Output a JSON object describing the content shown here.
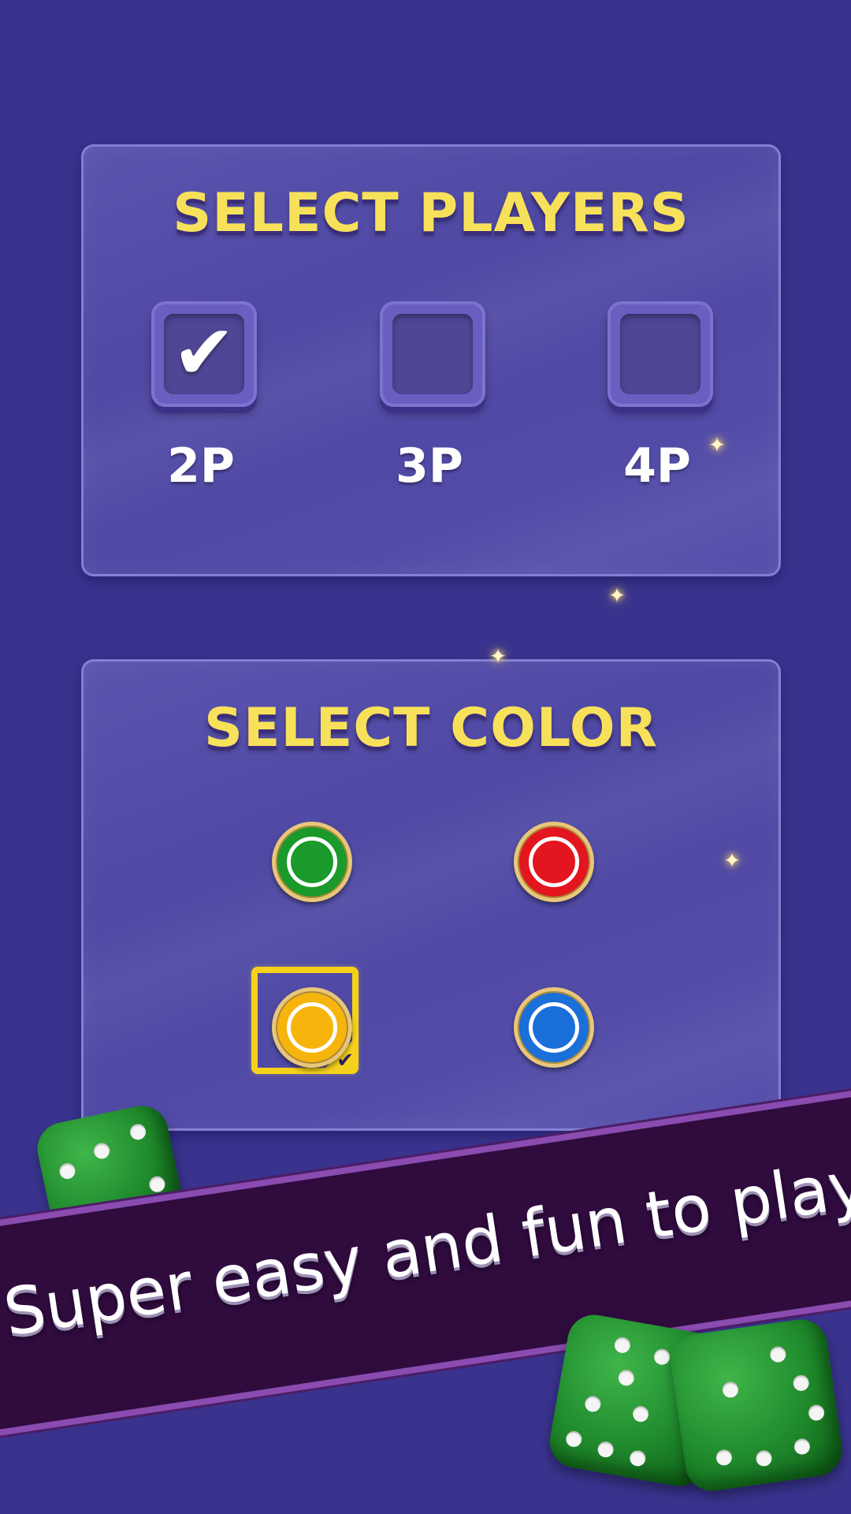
{
  "players_panel": {
    "title": "SELECT PLAYERS",
    "options": [
      {
        "label": "2P",
        "checked": true
      },
      {
        "label": "3P",
        "checked": false
      },
      {
        "label": "4P",
        "checked": false
      }
    ],
    "checkmark_glyph": "✔"
  },
  "color_panel": {
    "title": "SELECT COLOR",
    "tokens": [
      {
        "name": "green",
        "color": "#1a9a2a",
        "selected": false
      },
      {
        "name": "red",
        "color": "#e3151e",
        "selected": false
      },
      {
        "name": "yellow",
        "color": "#f6b40c",
        "selected": true
      },
      {
        "name": "blue",
        "color": "#1a6fd8",
        "selected": false
      }
    ],
    "selected_check_glyph": "✔"
  },
  "banner": {
    "text": "Super easy and fun to play"
  },
  "icons": {
    "sparkle": "✦",
    "dice": "green-dice-icon"
  },
  "colors": {
    "background": "#39338e",
    "title": "#f8e15a",
    "banner": "#2f0b3e",
    "selection_frame": "#f6d11c"
  }
}
